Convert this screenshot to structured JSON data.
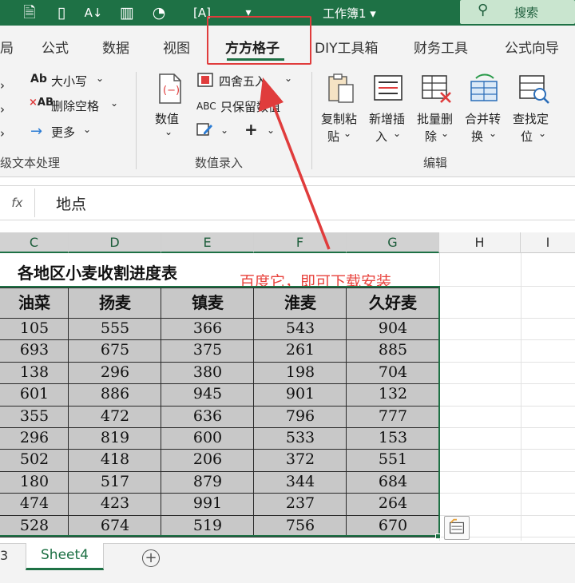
{
  "titlebar": {
    "workbook_title": "工作簿1 ▾",
    "search_label": "搜索"
  },
  "tabs": [
    {
      "label": "局"
    },
    {
      "label": "公式"
    },
    {
      "label": "数据"
    },
    {
      "label": "视图"
    },
    {
      "label": "方方格子"
    },
    {
      "label": "DIY工具箱"
    },
    {
      "label": "财务工具"
    },
    {
      "label": "公式向导"
    }
  ],
  "ribbon": {
    "text_group": {
      "case_label": "大小写",
      "remove_space_label": "删除空格",
      "more_label": "更多",
      "group_label": "级文本处理"
    },
    "numeric_group": {
      "value_label": "数值",
      "round_label": "四舍五入",
      "keep_value_label": "只保留数值",
      "group_label": "数值录入"
    },
    "edit_group": {
      "copy_paste_label1": "复制粘",
      "copy_paste_label2": "贴",
      "insert_label1": "新增插",
      "insert_label2": "入",
      "batch_delete_label1": "批量删",
      "batch_delete_label2": "除",
      "merge_label1": "合并转",
      "merge_label2": "换",
      "find_label1": "查找定",
      "find_label2": "位",
      "group_label": "编辑"
    }
  },
  "formula_bar": {
    "fx": "fx",
    "value": "地点"
  },
  "columns": [
    "C",
    "D",
    "E",
    "F",
    "G",
    "H",
    "I"
  ],
  "sheet": {
    "title": "各地区小麦收割进度表",
    "notice": "百度它，即可下载安装",
    "headers": [
      "油菜",
      "扬麦",
      "镇麦",
      "淮麦",
      "久好麦"
    ],
    "rows": [
      [
        105,
        555,
        366,
        543,
        904
      ],
      [
        693,
        675,
        375,
        261,
        885
      ],
      [
        138,
        296,
        380,
        198,
        704
      ],
      [
        601,
        886,
        945,
        901,
        132
      ],
      [
        355,
        472,
        636,
        796,
        777
      ],
      [
        296,
        819,
        600,
        533,
        153
      ],
      [
        502,
        418,
        206,
        372,
        551
      ],
      [
        180,
        517,
        879,
        344,
        684
      ],
      [
        474,
        423,
        991,
        237,
        264
      ],
      [
        528,
        674,
        519,
        756,
        670
      ]
    ]
  },
  "sheet_tabs": {
    "prev": "3",
    "active": "Sheet4",
    "add": "+"
  },
  "colors": {
    "accent": "#1e7145",
    "annotation": "#e03c3c",
    "selection": "#c8c8c8"
  }
}
